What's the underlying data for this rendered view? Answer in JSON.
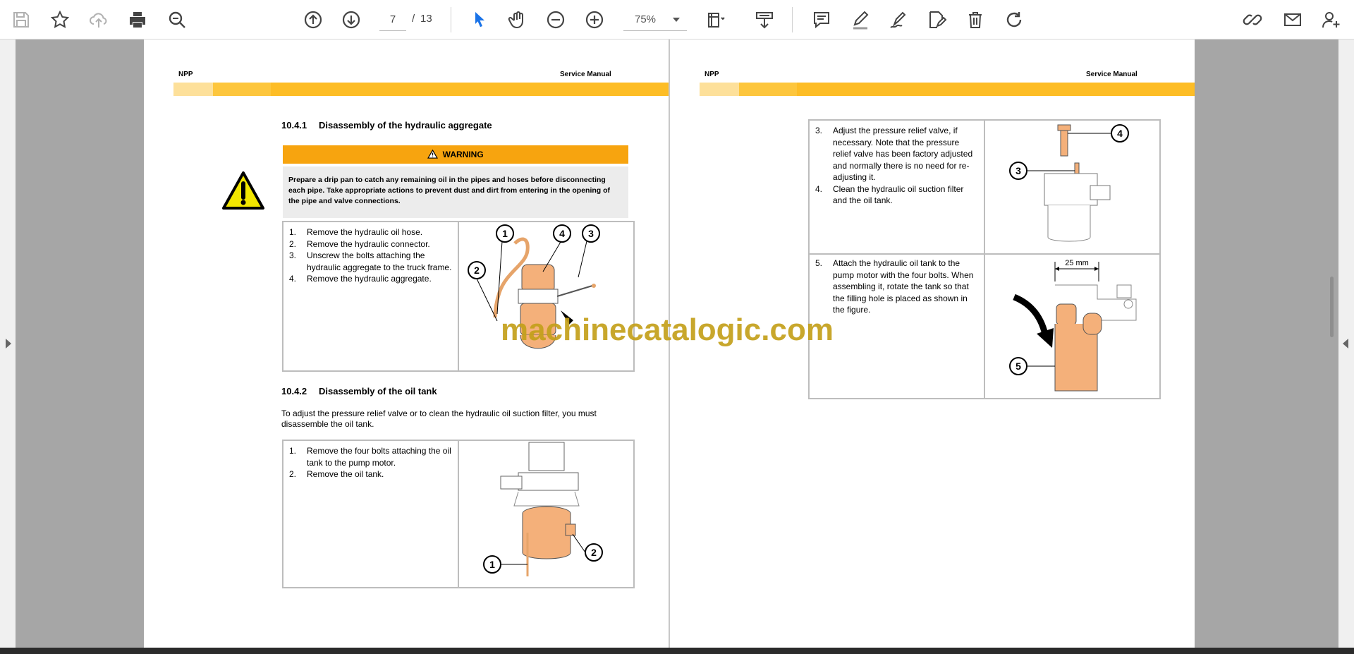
{
  "toolbar": {
    "buttons": {
      "save": "save-icon",
      "bookmark": "star-icon",
      "upload": "cloud-upload-icon",
      "print": "printer-icon",
      "search": "zoom-search-icon",
      "page_up": "arrow-up-circle-icon",
      "page_down": "arrow-down-circle-icon",
      "select": "cursor-icon",
      "hand": "hand-icon",
      "zoom_out": "minus-circle-icon",
      "zoom_in": "plus-circle-icon",
      "fit": "fit-page-icon",
      "download": "download-icon",
      "comment": "comment-icon",
      "highlight": "pencil-icon",
      "draw": "draw-icon",
      "sign": "sign-icon",
      "delete": "trash-icon",
      "rotate": "rotate-icon",
      "share_link": "link-icon",
      "email": "mail-icon",
      "add_user": "add-user-icon"
    },
    "page_current": "7",
    "page_separator": "/",
    "page_total": "13",
    "zoom": "75%",
    "accent_color": "#1a73e8"
  },
  "page_left": {
    "header_left": "NPP",
    "header_right": "Service Manual",
    "section1": {
      "number": "10.4.1",
      "title": "Disassembly of the hydraulic aggregate"
    },
    "warning": {
      "label": "WARNING",
      "text": "Prepare a drip pan to catch any remaining oil in the pipes and hoses before disconnecting each pipe. Take appropriate actions to prevent dust and dirt from entering in the opening of the pipe and valve connections."
    },
    "steps1": [
      {
        "n": "1.",
        "text": "Remove the hydraulic oil hose."
      },
      {
        "n": "2.",
        "text": "Remove the hydraulic connector."
      },
      {
        "n": "3.",
        "text": "Unscrew the bolts attaching the hydraulic aggregate to the truck frame."
      },
      {
        "n": "4.",
        "text": "Remove the hydraulic aggregate."
      }
    ],
    "figure1_callouts": [
      "1",
      "2",
      "4",
      "3"
    ],
    "section2": {
      "number": "10.4.2",
      "title": "Disassembly of the oil tank"
    },
    "intro2": "To adjust the pressure relief valve or to clean the hydraulic oil suction filter, you must disassemble the oil tank.",
    "steps2": [
      {
        "n": "1.",
        "text": "Remove the four bolts attaching the oil tank to the pump motor."
      },
      {
        "n": "2.",
        "text": "Remove the oil tank."
      }
    ],
    "figure2_callouts": [
      "1",
      "2"
    ]
  },
  "page_right": {
    "header_left": "NPP",
    "header_right": "Service Manual",
    "steps3": [
      {
        "n": "3.",
        "text": "Adjust the pressure relief valve, if necessary. Note that the pressure relief valve has been factory adjusted and normally there is no need for re-adjusting it."
      },
      {
        "n": "4.",
        "text": "Clean the hydraulic oil suction filter and the oil tank."
      }
    ],
    "figure3_callouts": [
      "4",
      "3"
    ],
    "steps4": [
      {
        "n": "5.",
        "text": "Attach the hydraulic oil tank to the pump motor with the four bolts. When assembling it, rotate the tank so that the filling hole is placed as shown in the figure."
      }
    ],
    "figure4_dimension": "25 mm",
    "figure4_callouts": [
      "5"
    ]
  },
  "watermark": "machinecatalogic.com",
  "colors": {
    "band_light": "#fde09a",
    "band_mid": "#fdc63d",
    "band_main": "#fdbd26",
    "warning_orange": "#f7a40f",
    "part_orange": "#f4b07a"
  }
}
